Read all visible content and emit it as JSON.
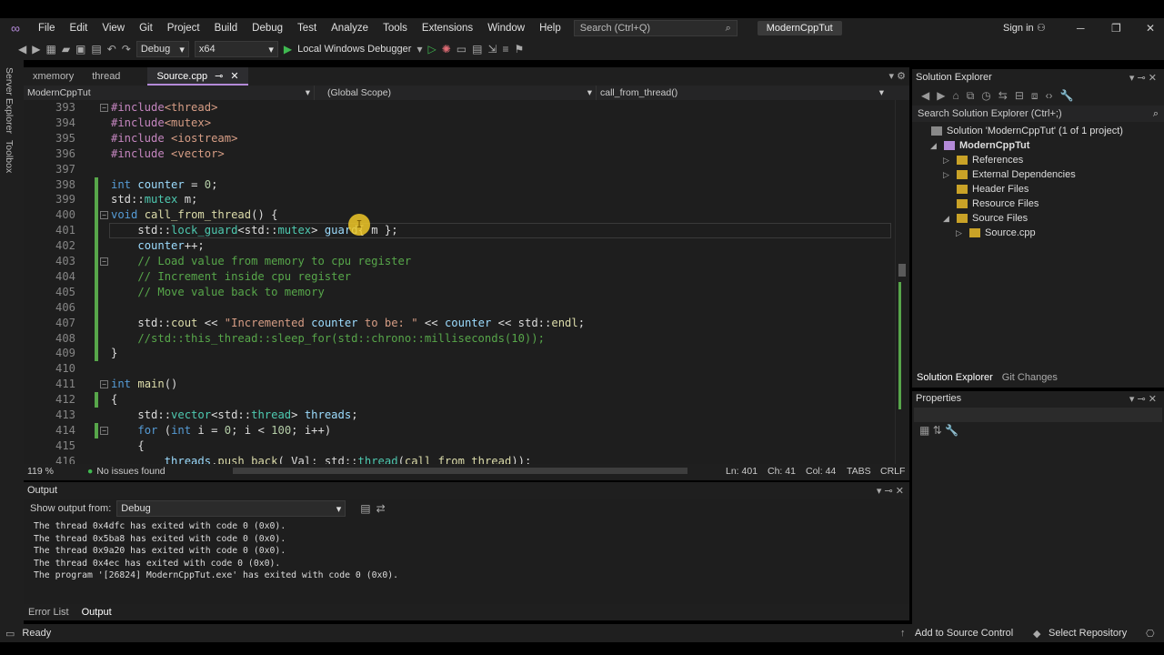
{
  "menu": {
    "items": [
      "File",
      "Edit",
      "View",
      "Git",
      "Project",
      "Build",
      "Debug",
      "Test",
      "Analyze",
      "Tools",
      "Extensions",
      "Window",
      "Help"
    ],
    "search_placeholder": "Search (Ctrl+Q)",
    "project_name": "ModernCppTut",
    "sign_in": "Sign in"
  },
  "toolbar": {
    "config": "Debug",
    "platform": "x64",
    "debugger": "Local Windows Debugger"
  },
  "side_tabs": [
    "Server Explorer",
    "Toolbox"
  ],
  "editor": {
    "tabs": [
      {
        "label": "xmemory"
      },
      {
        "label": "thread"
      },
      {
        "label": "Source.cpp",
        "active": true
      }
    ],
    "nav_project": "ModernCppTut",
    "nav_scope": "(Global Scope)",
    "nav_func": "call_from_thread()"
  },
  "code_lines": [
    {
      "n": "393",
      "html": "#include<thread>"
    },
    {
      "n": "394",
      "html": "#include<mutex>"
    },
    {
      "n": "395",
      "html": "#include <iostream>"
    },
    {
      "n": "396",
      "html": "#include <vector>"
    },
    {
      "n": "397",
      "html": ""
    },
    {
      "n": "398",
      "html": "int counter = 0;"
    },
    {
      "n": "399",
      "html": "std::mutex m;"
    },
    {
      "n": "400",
      "html": "void call_from_thread() {"
    },
    {
      "n": "401",
      "html": "    std::lock_guard<std::mutex> guard{ m };"
    },
    {
      "n": "402",
      "html": "    counter++;"
    },
    {
      "n": "403",
      "html": "    // Load value from memory to cpu register"
    },
    {
      "n": "404",
      "html": "    // Increment inside cpu register"
    },
    {
      "n": "405",
      "html": "    // Move value back to memory"
    },
    {
      "n": "406",
      "html": ""
    },
    {
      "n": "407",
      "html": "    std::cout << \"Incremented counter to be: \" << counter << std::endl;"
    },
    {
      "n": "408",
      "html": "    //std::this_thread::sleep_for(std::chrono::milliseconds(10));"
    },
    {
      "n": "409",
      "html": "}"
    },
    {
      "n": "410",
      "html": ""
    },
    {
      "n": "411",
      "html": "int main()"
    },
    {
      "n": "412",
      "html": "{"
    },
    {
      "n": "413",
      "html": "    std::vector<std::thread> threads;"
    },
    {
      "n": "414",
      "html": "    for (int i = 0; i < 100; i++)"
    },
    {
      "n": "415",
      "html": "    {"
    },
    {
      "n": "416",
      "html": "        threads.push_back( Val: std::thread(call_from_thread));"
    }
  ],
  "editor_status": {
    "zoom": "119 %",
    "issues": "No issues found",
    "ln": "Ln: 401",
    "ch": "Ch: 41",
    "col": "Col: 44",
    "tabs": "TABS",
    "eol": "CRLF"
  },
  "output": {
    "title": "Output",
    "show_from_label": "Show output from:",
    "source": "Debug",
    "lines": [
      "The thread 0x4dfc has exited with code 0 (0x0).",
      "The thread 0x5ba8 has exited with code 0 (0x0).",
      "The thread 0x9a20 has exited with code 0 (0x0).",
      "The thread 0x4ec has exited with code 0 (0x0).",
      "The program '[26824] ModernCppTut.exe' has exited with code 0 (0x0)."
    ]
  },
  "bottom_tabs": [
    "Error List",
    "Output"
  ],
  "solution": {
    "title": "Solution Explorer",
    "search_placeholder": "Search Solution Explorer (Ctrl+;)",
    "tree": [
      {
        "label": "Solution 'ModernCppTut' (1 of 1 project)",
        "indent": 0,
        "arrow": ""
      },
      {
        "label": "ModernCppTut",
        "indent": 1,
        "arrow": "◢",
        "bold": true
      },
      {
        "label": "References",
        "indent": 2,
        "arrow": "▷"
      },
      {
        "label": "External Dependencies",
        "indent": 2,
        "arrow": "▷"
      },
      {
        "label": "Header Files",
        "indent": 2,
        "arrow": ""
      },
      {
        "label": "Resource Files",
        "indent": 2,
        "arrow": ""
      },
      {
        "label": "Source Files",
        "indent": 2,
        "arrow": "◢"
      },
      {
        "label": "Source.cpp",
        "indent": 3,
        "arrow": "▷"
      }
    ],
    "tabs": [
      "Solution Explorer",
      "Git Changes"
    ]
  },
  "properties": {
    "title": "Properties"
  },
  "statusbar": {
    "ready": "Ready",
    "add_source": "Add to Source Control",
    "select_repo": "Select Repository"
  }
}
